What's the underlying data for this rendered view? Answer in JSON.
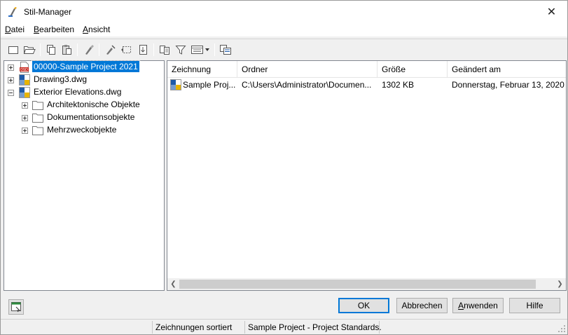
{
  "window": {
    "title": "Stil-Manager",
    "close_symbol": "✕"
  },
  "menu": [
    {
      "label_u": "D",
      "label_rest": "atei"
    },
    {
      "label_u": "B",
      "label_rest": "earbeiten"
    },
    {
      "label_u": "A",
      "label_rest": "nsicht"
    }
  ],
  "toolbar": {
    "icons": [
      "new-icon",
      "open-icon",
      "copy-icon",
      "paste-icon",
      "purge-icon",
      "edit-style-icon",
      "synchronize-icon",
      "import-icon",
      "compare-icon",
      "filter-icon",
      "view-icon",
      "toggle-view-icon"
    ]
  },
  "tree": {
    "items": [
      {
        "label": "00000-Sample Project 2021",
        "selected": true
      },
      {
        "label": "Drawing3.dwg"
      },
      {
        "label": "Exterior Elevations.dwg"
      },
      {
        "label": "Architektonische Objekte"
      },
      {
        "label": "Dokumentationsobjekte"
      },
      {
        "label": "Mehrzweckobjekte"
      }
    ]
  },
  "list": {
    "columns": [
      "Zeichnung",
      "Ordner",
      "Größe",
      "Geändert am"
    ],
    "rows": [
      [
        "Sample Proj...",
        "C:\\Users\\Administrator\\Documen...",
        "1302 KB",
        "Donnerstag, Februar 13, 2020"
      ]
    ]
  },
  "buttons": {
    "ok": "OK",
    "cancel": "Abbrechen",
    "apply_u": "A",
    "apply_rest": "nwenden",
    "help": "Hilfe"
  },
  "status": {
    "sorted": "Zeichnungen sortiert",
    "project": "Sample Project - Project Standards."
  },
  "colors": {
    "selection": "#0078d7",
    "accent_red": "#c8281e",
    "accent_blue": "#1e5aa8",
    "accent_yellow": "#e8b400"
  }
}
